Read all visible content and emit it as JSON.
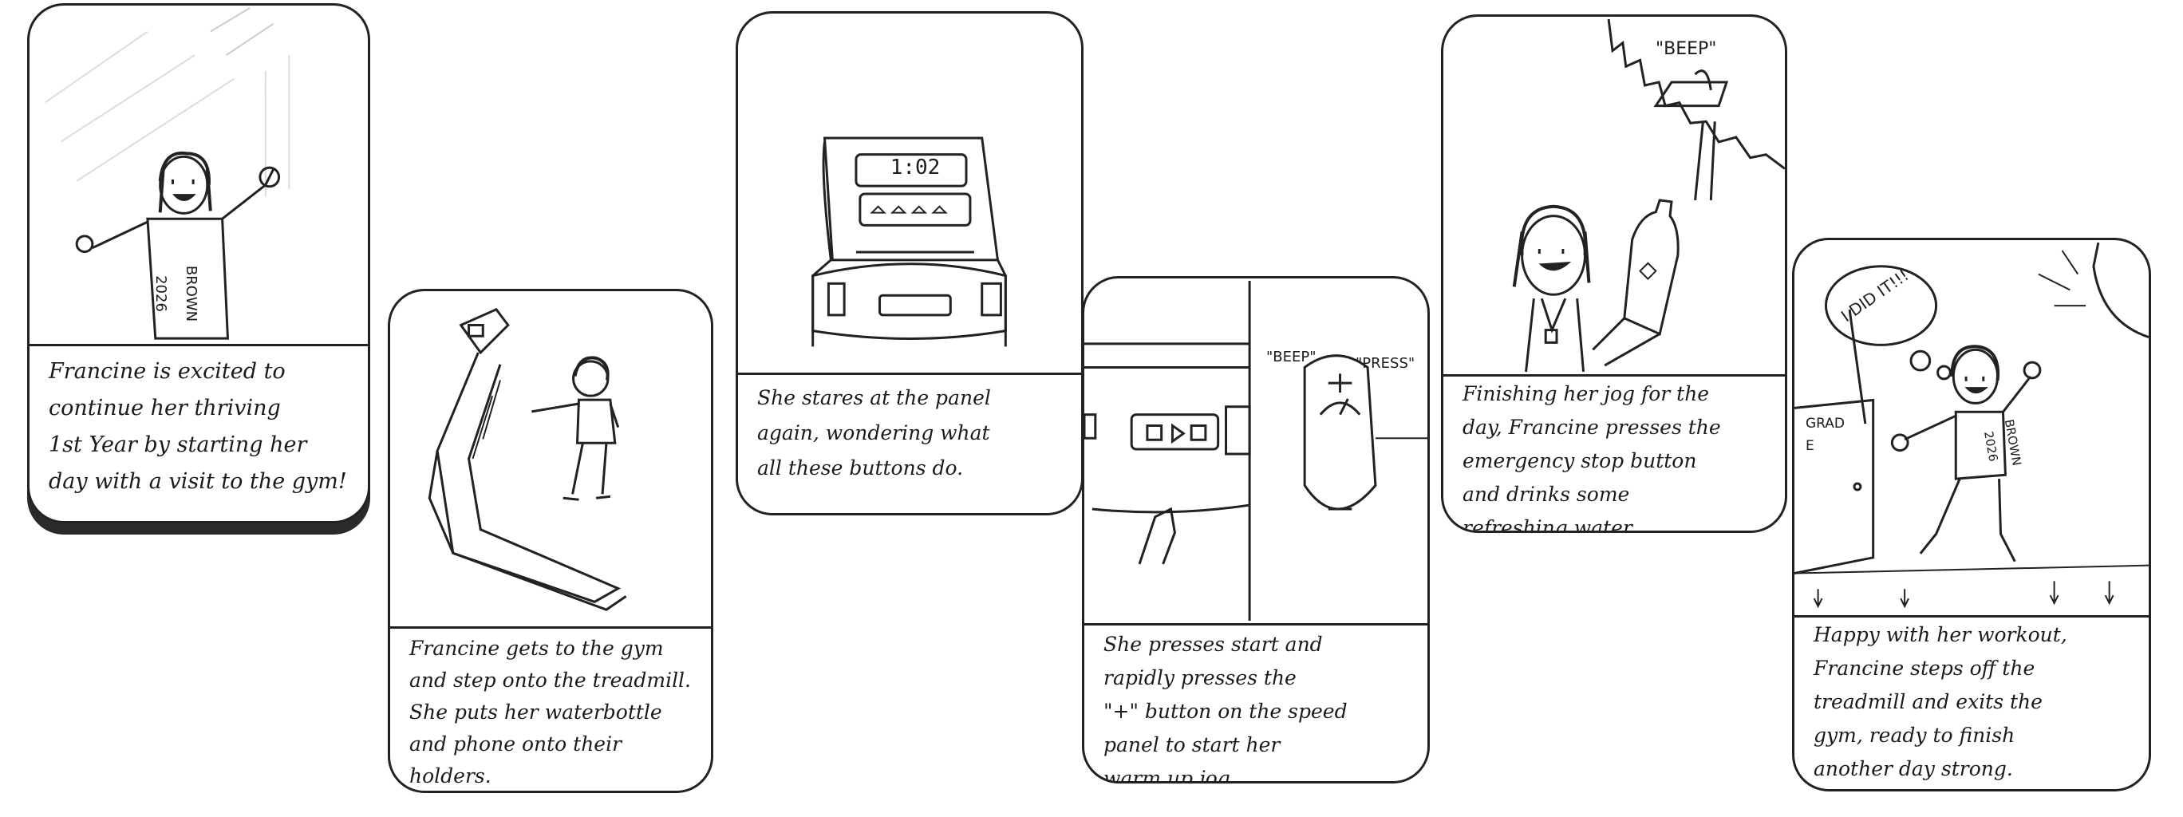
{
  "panels": [
    {
      "caption": "Francine is excited to\ncontinue her thriving\n1st Year by starting her\nday with a visit to the gym!",
      "shirt_text": "BROWN\n2026"
    },
    {
      "caption": "Francine gets to the gym\nand step onto the treadmill.\nShe puts her waterbottle\nand phone onto their\nholders."
    },
    {
      "caption": "She stares at the panel\nagain, wondering what\nall these buttons do.",
      "display_text": "1:02"
    },
    {
      "caption": "She presses start and\nrapidly presses the\n\"+\" button on the speed\npanel to start her\nwarm up jog.",
      "beep_text": "\"BEEP\"",
      "press_text": "\"PRESS\""
    },
    {
      "caption": "Finishing her jog for the\nday, Francine presses the\nemergency stop button\nand drinks some\nrefreshing water.",
      "beep_text": "\"BEEP\""
    },
    {
      "caption": "Happy with her workout,\nFrancine steps off the\ntreadmill and exits the\ngym, ready to finish\nanother day strong.",
      "bubble_text": "I DID IT!!!",
      "door_text": "GRAD\nE",
      "shirt_text": "BROWN\n2026"
    }
  ]
}
